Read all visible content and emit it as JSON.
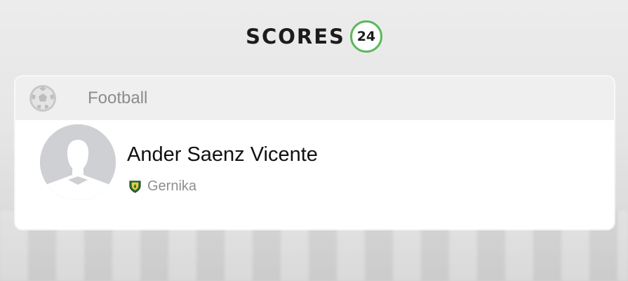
{
  "brand": {
    "word": "SCORES",
    "badge": "24",
    "accent_color": "#5cb85c"
  },
  "card": {
    "sport_icon": "football-icon",
    "sport_label": "Football"
  },
  "player": {
    "avatar_icon": "player-avatar-placeholder",
    "name": "Ander Saenz Vicente",
    "team": {
      "name": "Gernika",
      "badge_icon": "gernika-club-badge"
    }
  }
}
